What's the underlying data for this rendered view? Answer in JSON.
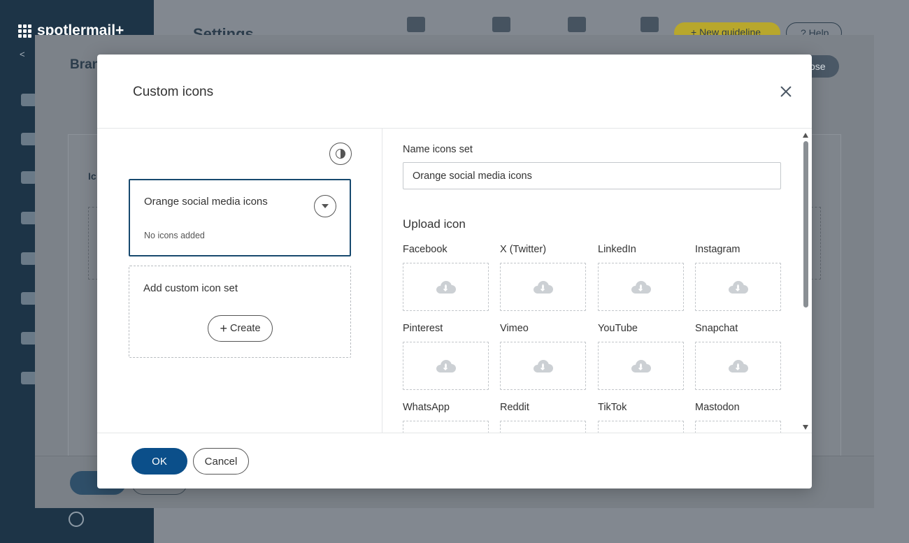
{
  "app": {
    "logo_text": "spotlermail+",
    "back_label": "<",
    "page_title": "Settings",
    "new_guideline_label": "+ New guideline",
    "help_label": "? Help",
    "panel_title": "Bran",
    "panel_close_label": "ose",
    "card_label": "Ic"
  },
  "modal": {
    "title": "Custom icons",
    "left": {
      "icon_set": {
        "name": "Orange social media icons",
        "status": "No icons added"
      },
      "add_set": {
        "label": "Add custom icon set",
        "create_label": "Create"
      }
    },
    "right": {
      "name_label": "Name icons set",
      "name_value": "Orange social media icons",
      "upload_title": "Upload icon",
      "icons": [
        {
          "label": "Facebook"
        },
        {
          "label": "X (Twitter)"
        },
        {
          "label": "LinkedIn"
        },
        {
          "label": "Instagram"
        },
        {
          "label": "Pinterest"
        },
        {
          "label": "Vimeo"
        },
        {
          "label": "YouTube"
        },
        {
          "label": "Snapchat"
        },
        {
          "label": "WhatsApp"
        },
        {
          "label": "Reddit"
        },
        {
          "label": "TikTok"
        },
        {
          "label": "Mastodon"
        }
      ]
    },
    "footer": {
      "ok_label": "OK",
      "cancel_label": "Cancel"
    }
  },
  "colors": {
    "primary": "#0b4f8a",
    "selected_border": "#17496e",
    "overlay_sidebar": "#1d3447"
  }
}
